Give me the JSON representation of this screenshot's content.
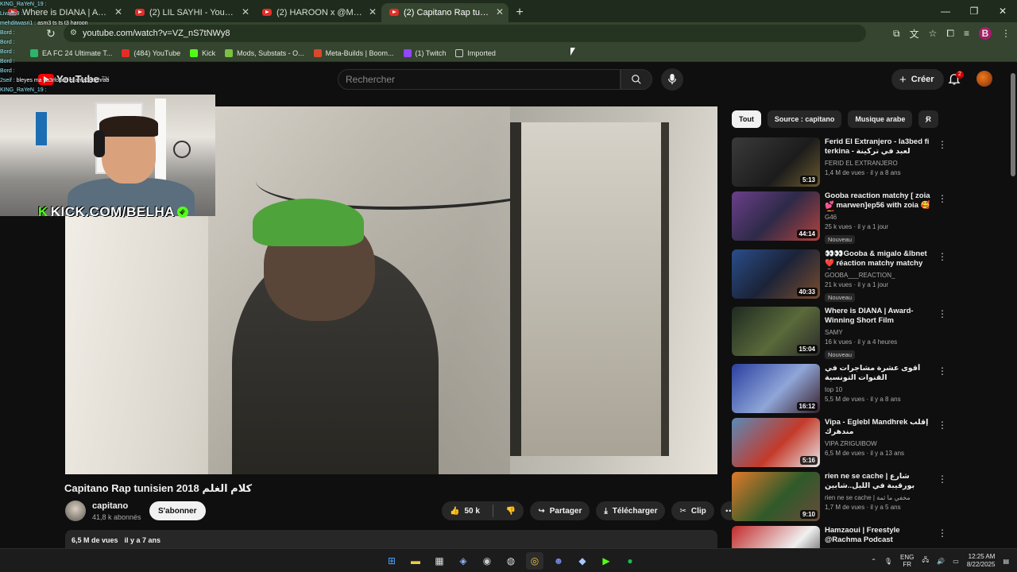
{
  "browser": {
    "tabs": [
      {
        "label": "Where is DIANA | Award-W",
        "active": false
      },
      {
        "label": "(2) LIL SAYHI - YouTube",
        "active": false
      },
      {
        "label": "(2) HAROON x @MEGBEATZ - !",
        "active": false
      },
      {
        "label": "(2) Capitano Rap tunisien 2(",
        "active": true
      }
    ],
    "new_tab": "+",
    "url": "youtube.com/watch?v=VZ_nS7tNWy8",
    "profile_initial": "B",
    "bookmarks": [
      "EA FC 24 Ultimate T...",
      "(484) YouTube",
      "Kick",
      "Mods, Substats - O...",
      "Meta-Builds | Boom...",
      "(1) Twitch",
      "Imported"
    ]
  },
  "youtube": {
    "logo_text": "YouTube",
    "logo_region": "TN",
    "search_placeholder": "Rechercher",
    "create_label": "Créer",
    "notif_count": "2"
  },
  "stream_overlay": {
    "chat": [
      {
        "user": "KING_RaYeN_19 :",
        "msg": ""
      },
      {
        "user": "Livado9 :",
        "msg": ""
      },
      {
        "user": "mehditwasri1 :",
        "msg": "asm3 ts ts t3 haroon"
      },
      {
        "user": "Bord :",
        "msg": ""
      },
      {
        "user": "Bord :",
        "msg": ""
      },
      {
        "user": "Bord :",
        "msg": ""
      },
      {
        "user": "Bord :",
        "msg": ""
      },
      {
        "user": "Bord :",
        "msg": ""
      },
      {
        "user": "2seif :",
        "msg": "bleyes ma ya3rfouch el ama3et chrab"
      },
      {
        "user": "KING_RaYeN_19 :",
        "msg": ""
      }
    ],
    "brand": "KICK.COM/BELHA"
  },
  "video": {
    "title": "Capitano Rap tunisien 2018 كلام الغلم",
    "channel": "capitano",
    "subscribers": "41,8 k abonnés",
    "subscribe_label": "S'abonner",
    "likes": "50 k",
    "share_label": "Partager",
    "download_label": "Télécharger",
    "clip_label": "Clip",
    "views": "6,5 M de vues",
    "age": "il y a 7 ans"
  },
  "sidebar": {
    "chips": [
      "Tout",
      "Source : capitano",
      "Musique arabe",
      "R"
    ],
    "recommendations": [
      {
        "title": "Ferid El Extranjero - la3bed fi terkina - لعبد في تركينة",
        "channel": "FERID EL EXTRANJERO",
        "meta": "1,4 M de vues · il y a 8 ans",
        "duration": "5:13",
        "new": ""
      },
      {
        "title": "Gooba reaction matchy [ zoia 💕 marwen]ep56 with zoia 🥰🥰...",
        "channel": "G46",
        "meta": "25 k vues · il y a 1 jour",
        "duration": "44:14",
        "new": "Nouveau"
      },
      {
        "title": "👀👀Gooba & migalo &lbnet ❤️ réaction matchy matchy 😂...",
        "channel": "GOOBA___REACTION_",
        "meta": "21 k vues · il y a 1 jour",
        "duration": "40:33",
        "new": "Nouveau"
      },
      {
        "title": "Where is DIANA | Award-Winning Short Film",
        "channel": "SAMY",
        "meta": "16 k vues · il y a 4 heures",
        "duration": "15:04",
        "new": "Nouveau"
      },
      {
        "title": "أقوى عشرة مشاجرات في القنوات التونسية",
        "channel": "top 10",
        "meta": "5,5 M de vues · il y a 8 ans",
        "duration": "16:12",
        "new": ""
      },
      {
        "title": "Vipa - Eglebl Mandhrek إقلب مندهرك",
        "channel": "VIPA ZRIGUIBOW",
        "meta": "6,5 M de vues · il y a 13 ans",
        "duration": "5:16",
        "new": ""
      },
      {
        "title": "rien ne se cache | شارع بورقيبة في الليل..شابين وزاعين ..تصهروا والضح مزاح",
        "channel": "rien ne se cache | مخفي ما ثمة",
        "meta": "1,7 M de vues · il y a 5 ans",
        "duration": "9:10",
        "new": ""
      },
      {
        "title": "Hamzaoui | Freestyle @Rachma Podcast",
        "channel": "",
        "meta": "",
        "duration": "",
        "new": ""
      }
    ]
  },
  "taskbar": {
    "lang_top": "ENG",
    "lang_bottom": "FR",
    "time": "12:25 AM",
    "date": "8/22/2025"
  }
}
